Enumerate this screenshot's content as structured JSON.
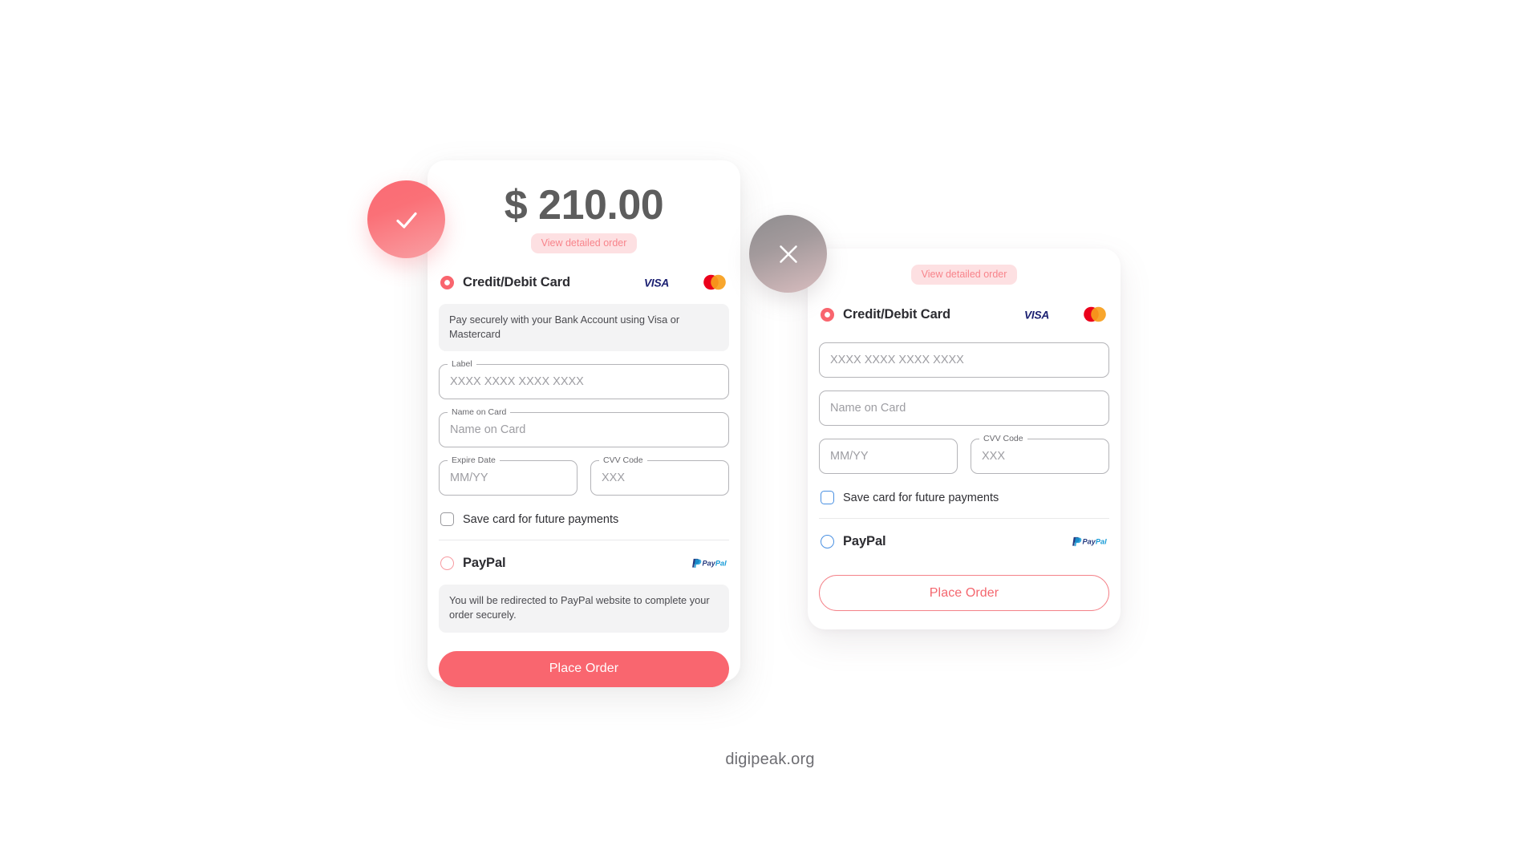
{
  "footer": {
    "brand": "digipeak.org"
  },
  "colors": {
    "accent": "#f9666f",
    "accent_soft": "#fde0e2",
    "accent_text": "#f8848b",
    "blue_outline": "#4a90e2",
    "visa_blue": "#1a1f71",
    "mastercard_red": "#eb001b",
    "mastercard_orange": "#f79e1b",
    "paypal_dark": "#253b80",
    "paypal_light": "#179bd7",
    "note_bg": "#f3f3f4",
    "text_dark": "#2c2c31",
    "text_muted": "#9d9da2"
  },
  "primary_card": {
    "status": {
      "icon": "check-icon",
      "type": "success"
    },
    "amount": "$ 210.00",
    "detail_link": "View detailed order",
    "card_method": {
      "label": "Credit/Debit Card",
      "selected": true,
      "logos": [
        "visa-logo",
        "mastercard-logo"
      ],
      "note": "Pay securely with your Bank Account using Visa or Mastercard"
    },
    "fields": [
      {
        "name": "card-number",
        "label": "Label",
        "placeholder": "XXXX XXXX XXXX XXXX",
        "value": ""
      },
      {
        "name": "name-on-card",
        "label": "Name on Card",
        "placeholder": "Name on Card",
        "value": ""
      },
      {
        "name": "expire-date",
        "label": "Expire Date",
        "placeholder": "MM/YY",
        "value": ""
      },
      {
        "name": "cvv-code",
        "label": "CVV Code",
        "placeholder": "XXX",
        "value": ""
      }
    ],
    "save_card": {
      "label": "Save card for future payments",
      "checked": false
    },
    "paypal_method": {
      "label": "PayPal",
      "selected": false,
      "logo": "paypal-logo",
      "note": "You will be redirected to PayPal website to complete your order securely."
    },
    "submit_label": "Place Order"
  },
  "secondary_card": {
    "status": {
      "icon": "close-icon",
      "type": "error"
    },
    "detail_link": "View detailed order",
    "card_method": {
      "label": "Credit/Debit Card",
      "selected": true,
      "logos": [
        "visa-logo",
        "mastercard-logo"
      ]
    },
    "fields": [
      {
        "name": "card-number",
        "label": "",
        "placeholder": "XXXX XXXX XXXX XXXX",
        "value": ""
      },
      {
        "name": "name-on-card",
        "label": "",
        "placeholder": "Name on Card",
        "value": ""
      },
      {
        "name": "expire-date",
        "label": "",
        "placeholder": "MM/YY",
        "value": ""
      },
      {
        "name": "cvv-code",
        "label": "CVV Code",
        "placeholder": "XXX",
        "value": ""
      }
    ],
    "save_card": {
      "label": "Save card for future payments",
      "checked": false
    },
    "paypal_method": {
      "label": "PayPal",
      "selected": false,
      "logo": "paypal-logo"
    },
    "submit_label": "Place Order"
  }
}
